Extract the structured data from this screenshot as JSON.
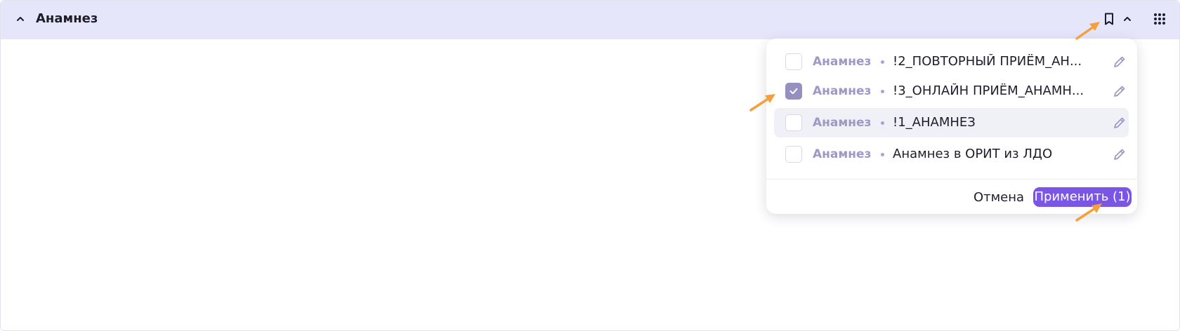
{
  "header": {
    "title": "Анамнез",
    "collapse_icon": "chevron-up-icon",
    "bookmark_icon": "bookmark-icon",
    "expand_icon": "chevron-up-icon",
    "apps_icon": "grid-icon"
  },
  "dropdown": {
    "items": [
      {
        "category": "Анамнез",
        "name": "!2_ПОВТОРНЫЙ ПРИЁМ_АН...",
        "checked": false
      },
      {
        "category": "Анамнез",
        "name": "!3_ОНЛАЙН ПРИЁМ_АНАМН...",
        "checked": true
      },
      {
        "category": "Анамнез",
        "name": "!1_АНАМНЕЗ",
        "checked": false
      },
      {
        "category": "Анамнез",
        "name": "Анамнез в ОРИТ из ЛДО",
        "checked": false
      }
    ],
    "cancel_label": "Отмена",
    "apply_label": "Применить (1)"
  },
  "colors": {
    "header_bg": "#e6e6fb",
    "accent": "#7b55e6",
    "checkbox_checked": "#9590c0",
    "category_text": "#9d98c6",
    "annotation_arrow": "#f5a03c"
  }
}
